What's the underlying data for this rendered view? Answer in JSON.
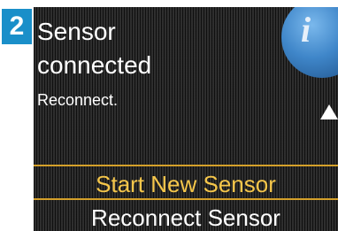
{
  "step_badge": "2",
  "screen": {
    "title_line1": "Sensor",
    "title_line2": "connected",
    "subtext": "Reconnect.",
    "info_icon": "info-icon",
    "scroll_indicator": "scroll-up-arrow-icon"
  },
  "menu": {
    "options": [
      {
        "label": "Start New Sensor",
        "selected": true
      },
      {
        "label": "Reconnect Sensor",
        "selected": false
      }
    ]
  },
  "colors": {
    "badge": "#1a8fc9",
    "selected_text": "#f5c64a",
    "selected_border": "#d4a02a",
    "screen_background": "#222222"
  }
}
